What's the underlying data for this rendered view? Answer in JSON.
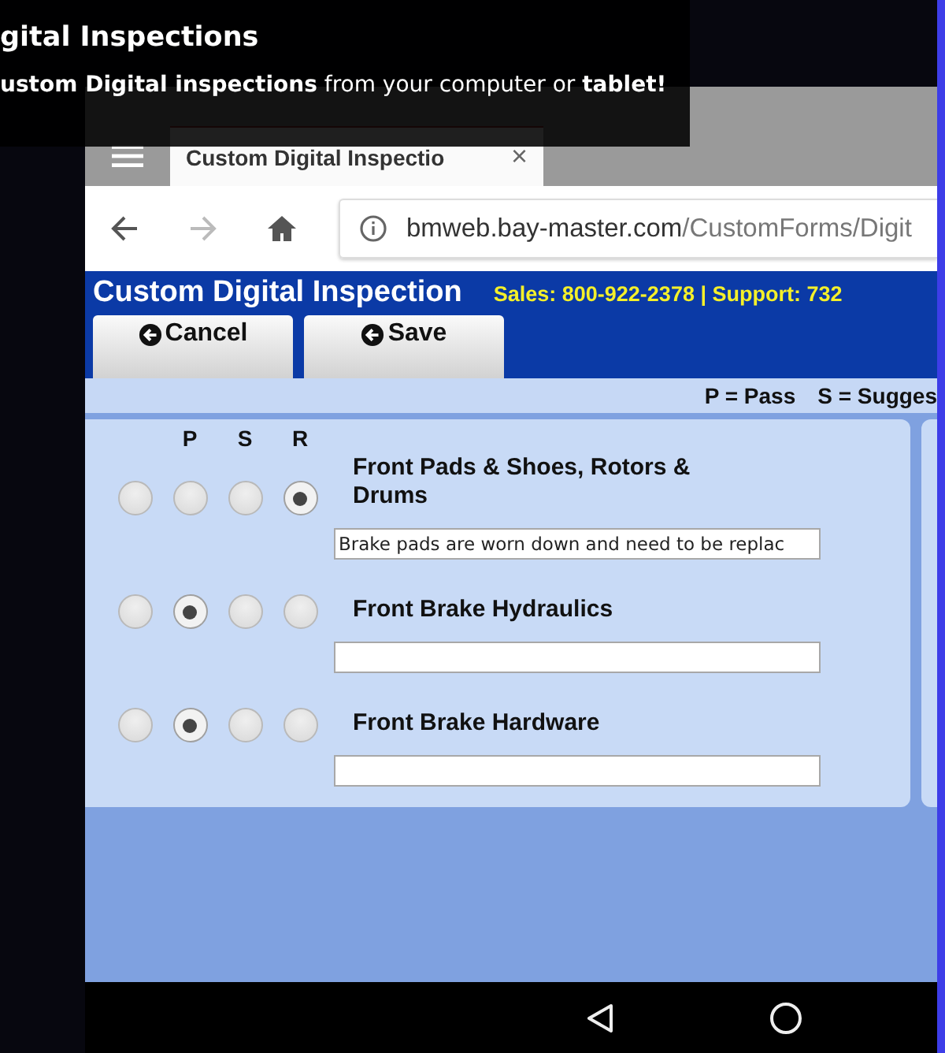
{
  "caption": {
    "title": "gital Inspections",
    "subtitle": "**ustom Digital inspections** from your computer or **tablet!**"
  },
  "browser": {
    "tab": {
      "title": "Custom Digital Inspectio",
      "close": "×"
    },
    "url": {
      "host": "bmweb.bay-master.com",
      "path": "/CustomForms/Digit"
    }
  },
  "header": {
    "title": "Custom Digital Inspection",
    "contact": "Sales: 800-922-2378 | Support: 732",
    "buttons": [
      "Cancel",
      "Save"
    ]
  },
  "legend": [
    "P = Pass",
    "S = Sugges"
  ],
  "column_headers": [
    "P",
    "S",
    "R"
  ],
  "rows": [
    {
      "label": "Front Pads & Shoes, Rotors & Drums",
      "note": "Brake pads are worn down and need to be replac",
      "options": [
        {
          "selected": false
        },
        {
          "selected": false
        },
        {
          "selected": false
        },
        {
          "selected": true
        }
      ]
    },
    {
      "label": "Front Brake Hydraulics",
      "options": [
        {
          "selected": false
        },
        {
          "selected": true
        },
        {
          "selected": false
        },
        {
          "selected": false
        }
      ]
    },
    {
      "label": "Front Brake Hardware",
      "options": [
        {
          "selected": false
        },
        {
          "selected": true
        },
        {
          "selected": false
        },
        {
          "selected": false
        }
      ]
    }
  ]
}
